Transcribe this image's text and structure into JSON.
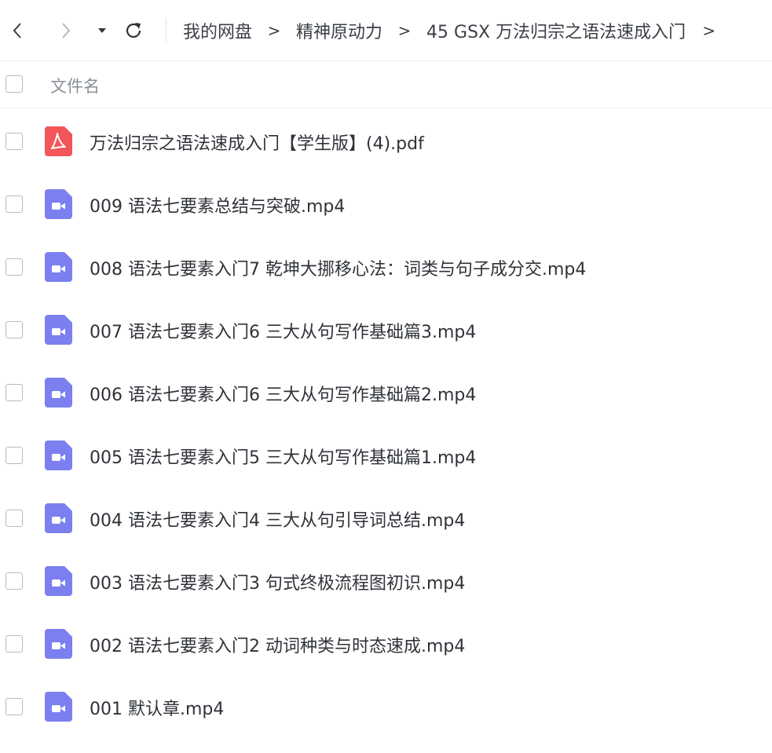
{
  "toolbar": {
    "back_icon": "chevron-left-icon",
    "forward_icon": "chevron-right-icon",
    "history_icon": "caret-down-icon",
    "refresh_icon": "refresh-icon",
    "breadcrumb": [
      "我的网盘",
      "精神原动力",
      "45 GSX 万法归宗之语法速成入门"
    ],
    "separator": ">"
  },
  "list_header": {
    "column_label": "文件名"
  },
  "files": [
    {
      "name": "万法归宗之语法速成入门【学生版】(4).pdf",
      "type": "pdf",
      "icon": "pdf-file-icon"
    },
    {
      "name": "009  语法七要素总结与突破.mp4",
      "type": "video",
      "icon": "video-file-icon"
    },
    {
      "name": "008  语法七要素入门7 乾坤大挪移心法：词类与句子成分交.mp4",
      "type": "video",
      "icon": "video-file-icon"
    },
    {
      "name": "007  语法七要素入门6 三大从句写作基础篇3.mp4",
      "type": "video",
      "icon": "video-file-icon"
    },
    {
      "name": "006  语法七要素入门6 三大从句写作基础篇2.mp4",
      "type": "video",
      "icon": "video-file-icon"
    },
    {
      "name": "005  语法七要素入门5 三大从句写作基础篇1.mp4",
      "type": "video",
      "icon": "video-file-icon"
    },
    {
      "name": "004  语法七要素入门4 三大从句引导词总结.mp4",
      "type": "video",
      "icon": "video-file-icon"
    },
    {
      "name": "003  语法七要素入门3 句式终极流程图初识.mp4",
      "type": "video",
      "icon": "video-file-icon"
    },
    {
      "name": "002  语法七要素入门2 动词种类与时态速成.mp4",
      "type": "video",
      "icon": "video-file-icon"
    },
    {
      "name": "001  默认章.mp4",
      "type": "video",
      "icon": "video-file-icon"
    }
  ],
  "colors": {
    "pdf_icon": "#f2555a",
    "video_icon": "#7b7ff0",
    "text": "#2f3339",
    "muted_text": "#8a8f98",
    "border": "#eceef1"
  }
}
